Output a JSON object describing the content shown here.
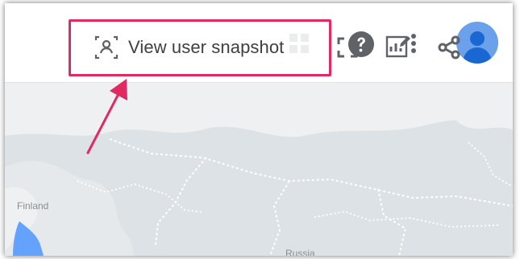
{
  "header": {
    "apps_icon": "apps-grid-icon",
    "help_icon": "help-circle-icon",
    "more_icon": "more-vertical-icon",
    "avatar_icon": "account-avatar-icon"
  },
  "toolbar": {
    "snapshot_label": "View user snapshot",
    "snapshot_icon": "user-snapshot-icon",
    "fullscreen_icon": "fullscreen-icon",
    "edit_report_icon": "edit-report-icon",
    "share_icon": "share-icon"
  },
  "map": {
    "labels": {
      "finland": "Finland",
      "russia": "Russia"
    }
  },
  "colors": {
    "highlight": "#e02a61",
    "icon": "#5f6368",
    "avatar_bg": "#6aa1ea",
    "map_land": "#dde2e6",
    "map_background": "#eef0f2"
  }
}
